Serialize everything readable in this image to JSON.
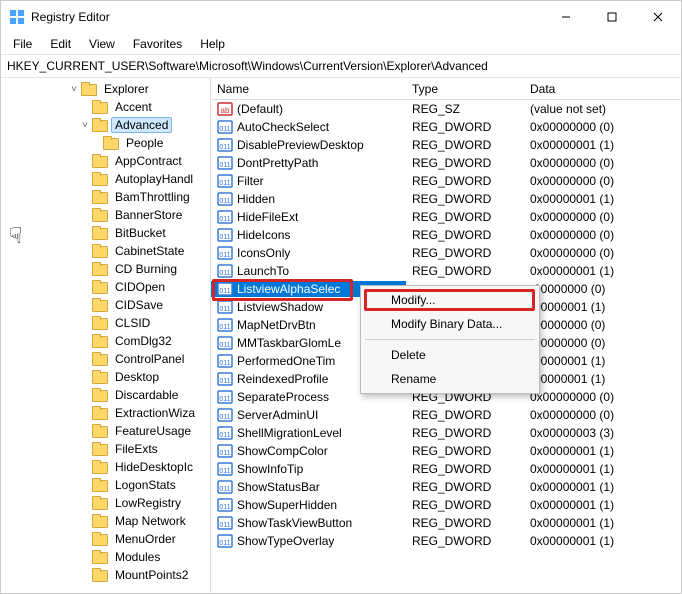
{
  "window": {
    "title": "Registry Editor"
  },
  "menubar": {
    "items": [
      "File",
      "Edit",
      "View",
      "Favorites",
      "Help"
    ]
  },
  "addressbar": {
    "path": "HKEY_CURRENT_USER\\Software\\Microsoft\\Windows\\CurrentVersion\\Explorer\\Advanced"
  },
  "tree": {
    "expanded_label": "Explorer",
    "selected_label": "Advanced",
    "nodes": [
      {
        "depth": 6,
        "chev": "˅",
        "label": "Explorer"
      },
      {
        "depth": 7,
        "chev": "",
        "label": "Accent"
      },
      {
        "depth": 7,
        "chev": "˅",
        "label": "Advanced",
        "selected": true
      },
      {
        "depth": 8,
        "chev": "",
        "label": "People"
      },
      {
        "depth": 7,
        "chev": "",
        "label": "AppContract"
      },
      {
        "depth": 7,
        "chev": "",
        "label": "AutoplayHandl"
      },
      {
        "depth": 7,
        "chev": "",
        "label": "BamThrottling"
      },
      {
        "depth": 7,
        "chev": "",
        "label": "BannerStore"
      },
      {
        "depth": 7,
        "chev": "",
        "label": "BitBucket"
      },
      {
        "depth": 7,
        "chev": "",
        "label": "CabinetState"
      },
      {
        "depth": 7,
        "chev": "",
        "label": "CD Burning"
      },
      {
        "depth": 7,
        "chev": "",
        "label": "CIDOpen"
      },
      {
        "depth": 7,
        "chev": "",
        "label": "CIDSave"
      },
      {
        "depth": 7,
        "chev": "",
        "label": "CLSID"
      },
      {
        "depth": 7,
        "chev": "",
        "label": "ComDlg32"
      },
      {
        "depth": 7,
        "chev": "",
        "label": "ControlPanel"
      },
      {
        "depth": 7,
        "chev": "",
        "label": "Desktop"
      },
      {
        "depth": 7,
        "chev": "",
        "label": "Discardable"
      },
      {
        "depth": 7,
        "chev": "",
        "label": "ExtractionWiza"
      },
      {
        "depth": 7,
        "chev": "",
        "label": "FeatureUsage"
      },
      {
        "depth": 7,
        "chev": "",
        "label": "FileExts"
      },
      {
        "depth": 7,
        "chev": "",
        "label": "HideDesktopIc"
      },
      {
        "depth": 7,
        "chev": "",
        "label": "LogonStats"
      },
      {
        "depth": 7,
        "chev": "",
        "label": "LowRegistry"
      },
      {
        "depth": 7,
        "chev": "",
        "label": "Map Network"
      },
      {
        "depth": 7,
        "chev": "",
        "label": "MenuOrder"
      },
      {
        "depth": 7,
        "chev": "",
        "label": "Modules"
      },
      {
        "depth": 7,
        "chev": "",
        "label": "MountPoints2"
      }
    ]
  },
  "columns": {
    "name": "Name",
    "type": "Type",
    "data": "Data"
  },
  "values": [
    {
      "icon": "str",
      "name": "(Default)",
      "type": "REG_SZ",
      "data": "(value not set)"
    },
    {
      "icon": "bin",
      "name": "AutoCheckSelect",
      "type": "REG_DWORD",
      "data": "0x00000000 (0)"
    },
    {
      "icon": "bin",
      "name": "DisablePreviewDesktop",
      "type": "REG_DWORD",
      "data": "0x00000001 (1)"
    },
    {
      "icon": "bin",
      "name": "DontPrettyPath",
      "type": "REG_DWORD",
      "data": "0x00000000 (0)"
    },
    {
      "icon": "bin",
      "name": "Filter",
      "type": "REG_DWORD",
      "data": "0x00000000 (0)"
    },
    {
      "icon": "bin",
      "name": "Hidden",
      "type": "REG_DWORD",
      "data": "0x00000001 (1)"
    },
    {
      "icon": "bin",
      "name": "HideFileExt",
      "type": "REG_DWORD",
      "data": "0x00000000 (0)"
    },
    {
      "icon": "bin",
      "name": "HideIcons",
      "type": "REG_DWORD",
      "data": "0x00000000 (0)"
    },
    {
      "icon": "bin",
      "name": "IconsOnly",
      "type": "REG_DWORD",
      "data": "0x00000000 (0)"
    },
    {
      "icon": "bin",
      "name": "LaunchTo",
      "type": "REG_DWORD",
      "data": "0x00000001 (1)"
    },
    {
      "icon": "bin",
      "name": "ListviewAlphaSelec",
      "type": "",
      "data": "‹00000000 (0)",
      "selected": true,
      "highlighted": true
    },
    {
      "icon": "bin",
      "name": "ListviewShadow",
      "type": "",
      "data": "‹00000001 (1)"
    },
    {
      "icon": "bin",
      "name": "MapNetDrvBtn",
      "type": "",
      "data": "‹00000000 (0)"
    },
    {
      "icon": "bin",
      "name": "MMTaskbarGlomLe",
      "type": "",
      "data": "‹00000000 (0)"
    },
    {
      "icon": "bin",
      "name": "PerformedOneTim",
      "type": "",
      "data": "‹00000001 (1)"
    },
    {
      "icon": "bin",
      "name": "ReindexedProfile",
      "type": "",
      "data": "‹00000001 (1)"
    },
    {
      "icon": "bin",
      "name": "SeparateProcess",
      "type": "REG_DWORD",
      "data": "0x00000000 (0)"
    },
    {
      "icon": "bin",
      "name": "ServerAdminUI",
      "type": "REG_DWORD",
      "data": "0x00000000 (0)"
    },
    {
      "icon": "bin",
      "name": "ShellMigrationLevel",
      "type": "REG_DWORD",
      "data": "0x00000003 (3)"
    },
    {
      "icon": "bin",
      "name": "ShowCompColor",
      "type": "REG_DWORD",
      "data": "0x00000001 (1)"
    },
    {
      "icon": "bin",
      "name": "ShowInfoTip",
      "type": "REG_DWORD",
      "data": "0x00000001 (1)"
    },
    {
      "icon": "bin",
      "name": "ShowStatusBar",
      "type": "REG_DWORD",
      "data": "0x00000001 (1)"
    },
    {
      "icon": "bin",
      "name": "ShowSuperHidden",
      "type": "REG_DWORD",
      "data": "0x00000001 (1)"
    },
    {
      "icon": "bin",
      "name": "ShowTaskViewButton",
      "type": "REG_DWORD",
      "data": "0x00000001 (1)"
    },
    {
      "icon": "bin",
      "name": "ShowTypeOverlay",
      "type": "REG_DWORD",
      "data": "0x00000001 (1)"
    }
  ],
  "contextmenu": {
    "items": [
      {
        "label": "Modify...",
        "highlighted": true
      },
      {
        "label": "Modify Binary Data..."
      },
      {
        "sep": true
      },
      {
        "label": "Delete"
      },
      {
        "label": "Rename"
      }
    ]
  }
}
